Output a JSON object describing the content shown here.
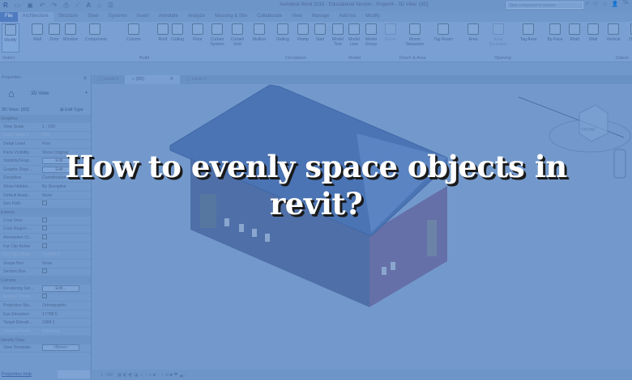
{
  "titlebar": {
    "app_title": "Autodesk Revit 2019 - Educational Version - Project4 - 3D View: {3D}",
    "search_placeholder": "Type a keyword or phrase",
    "user": "TA"
  },
  "menu_tabs": [
    "File",
    "Architecture",
    "Structure",
    "Steel",
    "Systems",
    "Insert",
    "Annotate",
    "Analyze",
    "Massing & Site",
    "Collaborate",
    "View",
    "Manage",
    "Add-Ins",
    "Modify"
  ],
  "ribbon": {
    "buttons": [
      "Modify",
      "Wall",
      "Door",
      "Window",
      "Component",
      "Column",
      "Roof",
      "Ceiling",
      "Floor",
      "Curtain System",
      "Curtain Grid",
      "Mullion",
      "Railing",
      "Ramp",
      "Stair",
      "Model Text",
      "Model Line",
      "Model Group",
      "Room",
      "Room Separator",
      "Tag Room",
      "Area",
      "Area Boundary",
      "Tag Area",
      "By Face",
      "Shaft",
      "Wall",
      "Vertical",
      "Dormer",
      "Level"
    ],
    "panels": [
      "Select",
      "Build",
      "Circulation",
      "Model",
      "Room & Area",
      "Opening",
      "Datum"
    ]
  },
  "properties": {
    "title": "Properties",
    "type_name": "3D View",
    "view_selector": "3D View: {3D}",
    "edit_type": "Edit Type",
    "categories": {
      "graphics": "Graphics",
      "extents": "Extents",
      "camera": "Camera",
      "identity": "Identity Data"
    },
    "graphics_rows": [
      [
        "View Scale",
        "1 : 100"
      ],
      [
        "Scale Value    1:",
        "100"
      ],
      [
        "Detail Level",
        "Fine"
      ],
      [
        "Parts Visibility",
        "Show Original"
      ],
      [
        "Visibility/Grap...",
        "Edit..."
      ],
      [
        "Graphic Displ...",
        "Edit..."
      ],
      [
        "Discipline",
        "Coordination"
      ],
      [
        "Show Hidden ...",
        "By Discipline"
      ],
      [
        "Default Analy...",
        "None"
      ],
      [
        "Sun Path",
        ""
      ]
    ],
    "extents_rows": [
      [
        "Crop View",
        ""
      ],
      [
        "Crop Region ...",
        ""
      ],
      [
        "Annotation Cr...",
        ""
      ],
      [
        "Far Clip Active",
        ""
      ],
      [
        "Far Clip Offset",
        "304800.0"
      ],
      [
        "Scope Box",
        "None"
      ],
      [
        "Section Box",
        ""
      ]
    ],
    "camera_rows": [
      [
        "Rendering Set...",
        "Edit..."
      ],
      [
        "Locked Orient...",
        ""
      ],
      [
        "Projection Mo...",
        "Orthographic"
      ],
      [
        "Eye Elevation",
        "17788.5"
      ],
      [
        "Target Elevati...",
        "1984.1"
      ],
      [
        "Camera Positi...",
        "Adjusting"
      ]
    ],
    "identity_rows": [
      [
        "View Template",
        "<None>"
      ]
    ],
    "help_link": "Properties help",
    "apply": "Apply"
  },
  "view_tabs": [
    "Level 1",
    "{3D}",
    "Level 2"
  ],
  "viewcube": {
    "label": "FRONT"
  },
  "status": {
    "scale": "1 : 100"
  },
  "headline": {
    "line1": "How to evenly space objects in",
    "line2": "revit?"
  },
  "colors": {
    "overlay": "#7198cb",
    "roof": "#4a74b4",
    "front_wall": "#4f6fa8",
    "side_wall": "#6570a8"
  }
}
